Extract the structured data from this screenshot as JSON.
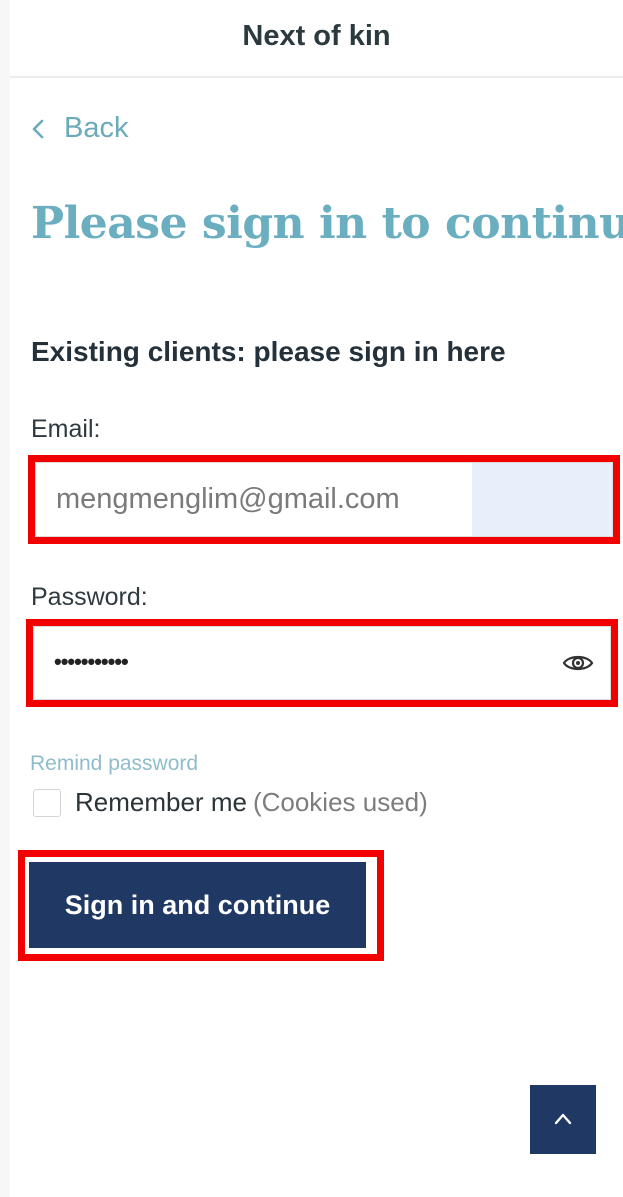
{
  "header": {
    "title": "Next of kin"
  },
  "nav": {
    "back_label": "Back"
  },
  "page": {
    "title": "Please sign in to continue",
    "subtitle": "Existing clients: please sign in here"
  },
  "form": {
    "email_label": "Email:",
    "email_value": "mengmenglim@gmail.com",
    "password_label": "Password:",
    "password_mask": "•••••••••••",
    "remind_password": "Remind password",
    "remember_me": "Remember me",
    "cookies_note": "(Cookies used)",
    "submit_label": "Sign in and continue"
  },
  "icons": {
    "back": "chevron-left-icon",
    "password_toggle": "eye-icon",
    "scroll_top": "chevron-up-icon"
  },
  "colors": {
    "accent": "#6aaec0",
    "link": "#8fbccb",
    "primary_button": "#1f3864",
    "highlight": "#f20000",
    "autofill": "#e8effb"
  }
}
